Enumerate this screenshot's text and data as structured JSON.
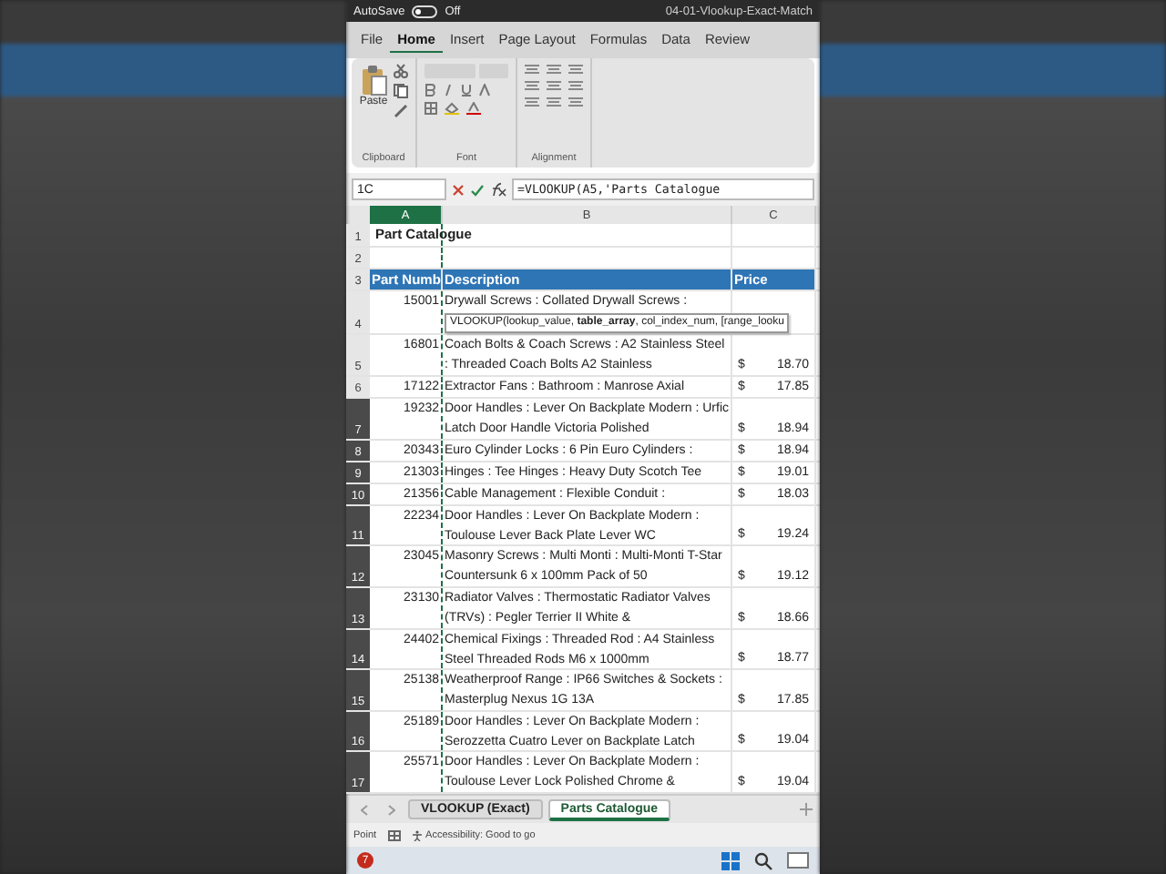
{
  "title_bar": {
    "autosave_label": "AutoSave",
    "autosave_on": false,
    "autosave_state": "Off",
    "file_name": "04-01-Vlookup-Exact-Match"
  },
  "ribbon_tabs": [
    {
      "label": "File",
      "selected": false
    },
    {
      "label": "Home",
      "selected": true
    },
    {
      "label": "Insert",
      "selected": false
    },
    {
      "label": "Page Layout",
      "selected": false
    },
    {
      "label": "Formulas",
      "selected": false
    },
    {
      "label": "Data",
      "selected": false
    },
    {
      "label": "Review",
      "selected": false
    }
  ],
  "ribbon_groups": [
    {
      "kind": "clipboard",
      "label": "Clipboard",
      "button_label": "Paste"
    },
    {
      "kind": "font",
      "label": "Font"
    },
    {
      "kind": "alignment",
      "label": "Alignment"
    }
  ],
  "formula_bar": {
    "name_box": "1C",
    "formula": "=VLOOKUP(A5,'Parts Catalogue"
  },
  "columns": [
    {
      "label": "A",
      "selected": true
    },
    {
      "label": "B",
      "selected": false
    },
    {
      "label": "C",
      "selected": false
    }
  ],
  "rows": [
    {
      "number": "1",
      "kind": "title",
      "selected": false,
      "text": "Part Catalogue"
    },
    {
      "number": "2",
      "kind": "blank",
      "selected": false
    },
    {
      "number": "3",
      "kind": "header",
      "selected": false,
      "cells": [
        "Part Numb",
        "Description",
        "Price"
      ]
    },
    {
      "number": "4",
      "kind": "item",
      "selected": false,
      "part": "15001",
      "description": "Drywall Screws : Collated Drywall Screws :",
      "tooltip": "VLOOKUP(lookup_value, **table_array**, col_index_num, [range_looku"
    },
    {
      "number": "5",
      "kind": "item",
      "selected": false,
      "part": "16801",
      "description": "Coach Bolts & Coach Screws : A2 Stainless Steel : Threaded Coach Bolts A2 Stainless",
      "currency": "$",
      "price": "18.70"
    },
    {
      "number": "6",
      "kind": "item",
      "selected": false,
      "part": "17122",
      "description": "Extractor Fans : Bathroom : Manrose Axial",
      "currency": "$",
      "price": "17.85"
    },
    {
      "number": "7",
      "kind": "item",
      "selected": true,
      "part": "19232",
      "description": "Door Handles : Lever On Backplate Modern : Urfic Latch Door Handle Victoria Polished",
      "currency": "$",
      "price": "18.94"
    },
    {
      "number": "8",
      "kind": "item",
      "selected": true,
      "part": "20343",
      "description": "Euro Cylinder Locks : 6 Pin Euro Cylinders :",
      "currency": "$",
      "price": "18.94"
    },
    {
      "number": "9",
      "kind": "item",
      "selected": true,
      "part": "21303",
      "description": "Hinges : Tee Hinges : Heavy Duty Scotch Tee",
      "currency": "$",
      "price": "19.01"
    },
    {
      "number": "10",
      "kind": "item",
      "selected": true,
      "part": "21356",
      "description": "Cable Management : Flexible Conduit :",
      "currency": "$",
      "price": "18.03"
    },
    {
      "number": "11",
      "kind": "item",
      "selected": true,
      "part": "22234",
      "description": "Door Handles : Lever On Backplate Modern : Toulouse Lever Back Plate Lever WC",
      "currency": "$",
      "price": "19.24"
    },
    {
      "number": "12",
      "kind": "item",
      "selected": true,
      "part": "23045",
      "description": "Masonry Screws : Multi Monti : Multi-Monti T-Star Countersunk 6 x 100mm Pack of 50",
      "currency": "$",
      "price": "19.12"
    },
    {
      "number": "13",
      "kind": "item",
      "selected": true,
      "part": "23130",
      "description": "Radiator Valves : Thermostatic Radiator Valves (TRVs) : Pegler Terrier II White &",
      "currency": "$",
      "price": "18.66"
    },
    {
      "number": "14",
      "kind": "item",
      "selected": true,
      "part": "24402",
      "description": "Chemical Fixings : Threaded Rod : A4 Stainless Steel Threaded Rods M6 x 1000mm",
      "currency": "$",
      "price": "18.77"
    },
    {
      "number": "15",
      "kind": "item",
      "selected": true,
      "part": "25138",
      "description": "Weatherproof Range : IP66 Switches & Sockets : Masterplug Nexus 1G 13A",
      "currency": "$",
      "price": "17.85"
    },
    {
      "number": "16",
      "kind": "item",
      "selected": true,
      "part": "25189",
      "description": "Door Handles : Lever On Backplate Modern : Serozzetta Cuatro Lever on Backplate Latch",
      "currency": "$",
      "price": "19.04"
    },
    {
      "number": "17",
      "kind": "item",
      "selected": true,
      "part": "25571",
      "description": "Door Handles : Lever On Backplate Modern : Toulouse Lever Lock Polished Chrome &",
      "currency": "$",
      "price": "19.04"
    }
  ],
  "sheet_tabs": [
    {
      "label": "VLOOKUP (Exact)",
      "selected": false
    },
    {
      "label": "Parts Catalogue",
      "selected": true
    }
  ],
  "status_bar": {
    "mode": "Point",
    "accessibility": "Accessibility: Good to go"
  },
  "taskbar": {
    "badge": "7"
  }
}
